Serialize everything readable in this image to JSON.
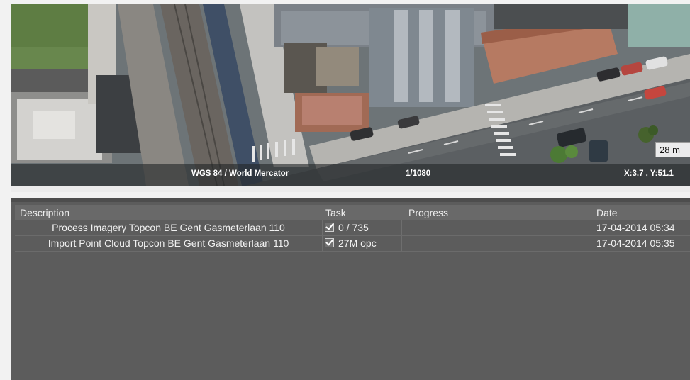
{
  "map": {
    "projection": "WGS 84 / World Mercator",
    "scale": "1/1080",
    "coords": "X:3.7 , Y:51.1",
    "scalebar_label": "28 m"
  },
  "tasks": {
    "headers": {
      "description": "Description",
      "task": "Task",
      "progress": "Progress",
      "date": "Date"
    },
    "rows": [
      {
        "description": "Process Imagery Topcon BE Gent Gasmeterlaan 110",
        "task": "0 / 735",
        "checked": true,
        "progress": "",
        "date": "17-04-2014 05:34"
      },
      {
        "description": "Import Point Cloud Topcon BE Gent Gasmeterlaan 110",
        "task": "27M opc",
        "checked": true,
        "progress": "",
        "date": "17-04-2014 05:35"
      }
    ]
  }
}
